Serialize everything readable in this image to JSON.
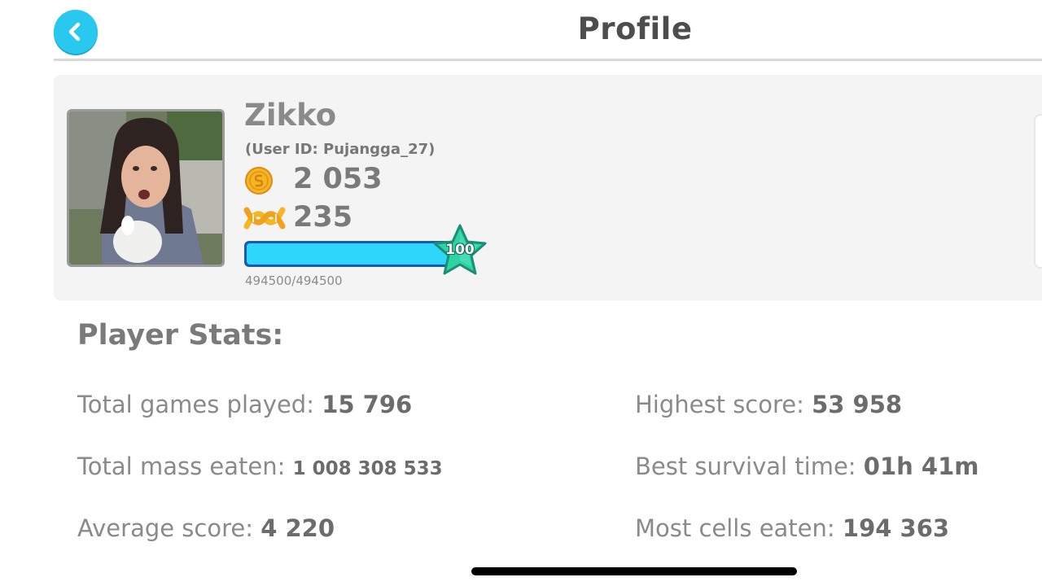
{
  "header": {
    "title": "Profile"
  },
  "profile": {
    "name": "Zikko",
    "user_id": "(User ID: Pujangga_27)",
    "coins": "2 053",
    "dna": "235",
    "level": "100",
    "xp_text": "494500/494500",
    "xp_progress": 1.0
  },
  "stats": {
    "title": "Player Stats:",
    "total_games_label": "Total games played:",
    "total_games_value": "15 796",
    "highest_score_label": "Highest score:",
    "highest_score_value": "53 958",
    "total_mass_label": "Total mass eaten:",
    "total_mass_value": "1 008 308 533",
    "best_survival_label": "Best survival time:",
    "best_survival_value": "01h 41m",
    "average_score_label": "Average score:",
    "average_score_value": "4 220",
    "most_cells_label": "Most cells eaten:",
    "most_cells_value": "194 363"
  },
  "colors": {
    "accent": "#29c8ee",
    "xp_fill": "#2fd6fb",
    "star": "#2ed3a6",
    "coin": "#f5b623"
  },
  "icons": {
    "back": "chevron-left-icon",
    "coin": "coin-icon",
    "dna": "dna-icon",
    "level": "star-icon"
  }
}
